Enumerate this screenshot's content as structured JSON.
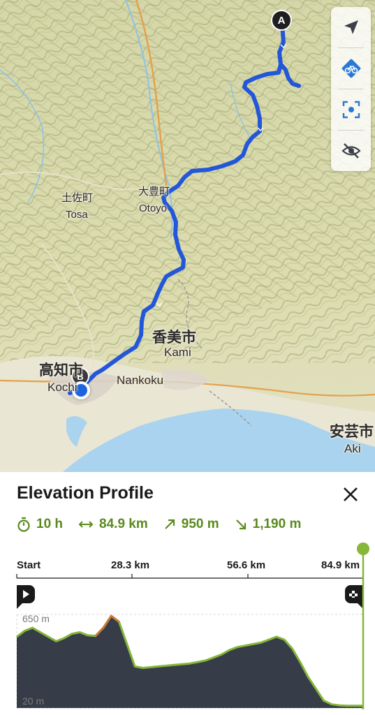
{
  "map": {
    "labels": {
      "tosa_jp": "土佐町",
      "tosa_en": "Tosa",
      "otoyo_jp": "大豊町",
      "otoyo_en": "Otoyo",
      "kami_jp": "香美市",
      "kami_en": "Kami",
      "nankoku": "Nankoku",
      "kochi_jp": "高知市",
      "kochi_en": "Kochi",
      "aki_jp": "安芸市",
      "aki_en": "Aki"
    },
    "markers": {
      "start": "A",
      "end": "B"
    },
    "colors": {
      "route": "#2356d8",
      "water": "#a9d3ee",
      "land": "#dde0b6"
    }
  },
  "toolbar": {
    "items": [
      {
        "icon": "navigation-arrow-icon"
      },
      {
        "icon": "bike-mode-icon"
      },
      {
        "icon": "recenter-icon"
      },
      {
        "icon": "hide-eye-icon"
      }
    ]
  },
  "sheet": {
    "title": "Elevation Profile",
    "stats": {
      "duration": "10 h",
      "distance": "84.9 km",
      "ascent": "950 m",
      "descent": "1,190 m"
    },
    "axis": {
      "start": "Start",
      "mid1": "28.3 km",
      "mid2": "56.6 km",
      "end": "84.9 km"
    },
    "elevation": {
      "max_label": "650 m",
      "min_label": "20 m",
      "max_m": 650,
      "min_m": 20,
      "profile_m": [
        500,
        540,
        560,
        530,
        500,
        470,
        490,
        520,
        530,
        510,
        505,
        560,
        640,
        600,
        450,
        300,
        290,
        295,
        300,
        305,
        310,
        315,
        320,
        330,
        340,
        360,
        380,
        410,
        430,
        440,
        450,
        460,
        480,
        500,
        480,
        420,
        330,
        230,
        150,
        70,
        45,
        38,
        35,
        35,
        35
      ]
    },
    "colors": {
      "accent": "#86b63a",
      "fill": "#373d48"
    }
  }
}
